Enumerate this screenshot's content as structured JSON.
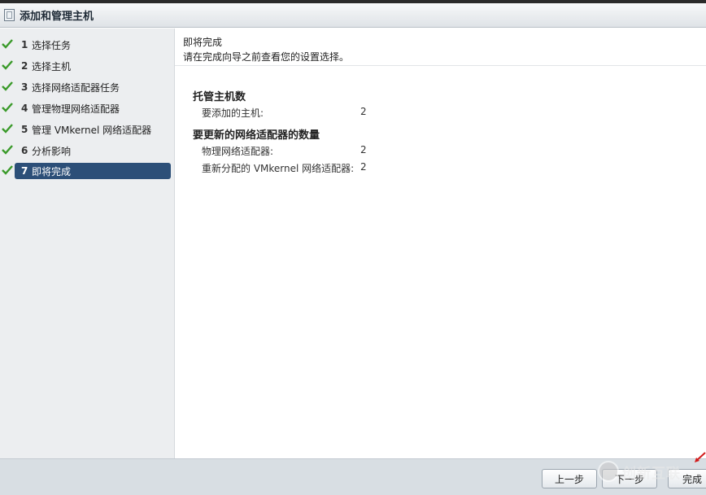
{
  "window": {
    "title": "添加和管理主机",
    "icon": "window-wizard-icon"
  },
  "steps": [
    {
      "num": "1",
      "label": "选择任务",
      "done": true
    },
    {
      "num": "2",
      "label": "选择主机",
      "done": true
    },
    {
      "num": "3",
      "label": "选择网络适配器任务",
      "done": true
    },
    {
      "num": "4",
      "label": "管理物理网络适配器",
      "done": true
    },
    {
      "num": "5",
      "label": "管理 VMkernel 网络适配器",
      "done": true
    },
    {
      "num": "6",
      "label": "分析影响",
      "done": true
    },
    {
      "num": "7",
      "label": "即将完成",
      "done": true,
      "active": true
    }
  ],
  "main": {
    "heading": "即将完成",
    "subheading": "请在完成向导之前查看您的设置选择。",
    "section1": {
      "title": "托管主机数",
      "rows": [
        {
          "label": "要添加的主机:",
          "value": "2"
        }
      ]
    },
    "section2": {
      "title": "要更新的网络适配器的数量",
      "rows": [
        {
          "label": "物理网络适配器:",
          "value": "2"
        },
        {
          "label": "重新分配的 VMkernel 网络适配器:",
          "value": "2"
        }
      ]
    }
  },
  "footer": {
    "back_label": "上一步",
    "next_label": "下一步",
    "finish_label": "完成",
    "watermark": "创新互联"
  },
  "colors": {
    "active_step": "#2c4f78",
    "check": "#3a9a2a",
    "footer_bg": "#d8dee3"
  }
}
